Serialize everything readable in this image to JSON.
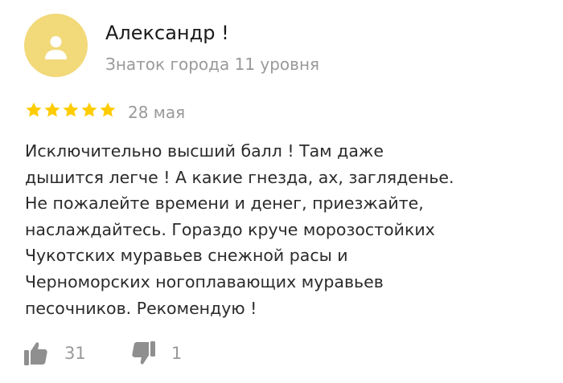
{
  "review": {
    "author": {
      "name": "Александр !",
      "level": "Знаток города 11 уровня",
      "avatar_icon": "user-silhouette-icon",
      "avatar_color": "#f2d97a"
    },
    "rating": {
      "value": 5,
      "max": 5,
      "star_icon": "star-icon",
      "star_color": "#ffcc00"
    },
    "date": "28 мая",
    "text_lines": [
      "Исключительно высший балл ! Там даже",
      "дышится легче ! А какие гнезда, ах, загляденье.",
      "Не пожалейте времени и денег, приезжайте,",
      "наслаждайтесь. Гораздо круче морозостойких",
      "Чукотских муравьев снежной расы и",
      "Черноморских ногоплавающих муравьев",
      "песочников. Рекомендую !"
    ],
    "reactions": {
      "likes": {
        "icon": "thumbs-up-icon",
        "count": "31"
      },
      "dislikes": {
        "icon": "thumbs-down-icon",
        "count": "1"
      }
    }
  }
}
